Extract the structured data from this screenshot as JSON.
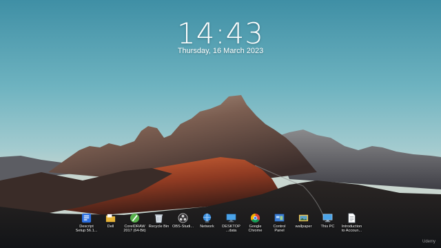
{
  "lock_screen": {
    "time": "14:43",
    "date": "Thursday, 16 March 2023"
  },
  "desktop_icons": [
    {
      "label": "Descript\nSetup 56.1...",
      "icon": "descript-setup-icon",
      "color": "#2d6fe0"
    },
    {
      "label": "Dell",
      "icon": "folder-icon",
      "color": "#f2c34c"
    },
    {
      "label": "CorelDRAW\n2017 (64-Bit)",
      "icon": "coreldraw-icon",
      "color": "#57b04a"
    },
    {
      "label": "Recycle Bin",
      "icon": "recycle-bin-icon",
      "color": "#dfe6ee"
    },
    {
      "label": "OBS-Studi...",
      "icon": "obs-studio-icon",
      "color": "#302e31"
    },
    {
      "label": "Network",
      "icon": "network-icon",
      "color": "#3a8fe0"
    },
    {
      "label": "DESKTOP\n...data",
      "icon": "desktop-data-icon",
      "color": "#4aa3e8"
    },
    {
      "label": "Google\nChrome",
      "icon": "chrome-icon",
      "color": "#db4437"
    },
    {
      "label": "Control\nPanel",
      "icon": "control-panel-icon",
      "color": "#3d7fd6"
    },
    {
      "label": "wallpaper",
      "icon": "image-file-icon",
      "color": "#f2c34c"
    },
    {
      "label": "This PC",
      "icon": "this-pc-icon",
      "color": "#4aa3e8"
    },
    {
      "label": "Introduction\nto Accoun...",
      "icon": "document-icon",
      "color": "#ffffff"
    }
  ],
  "watermark": "Udemy"
}
